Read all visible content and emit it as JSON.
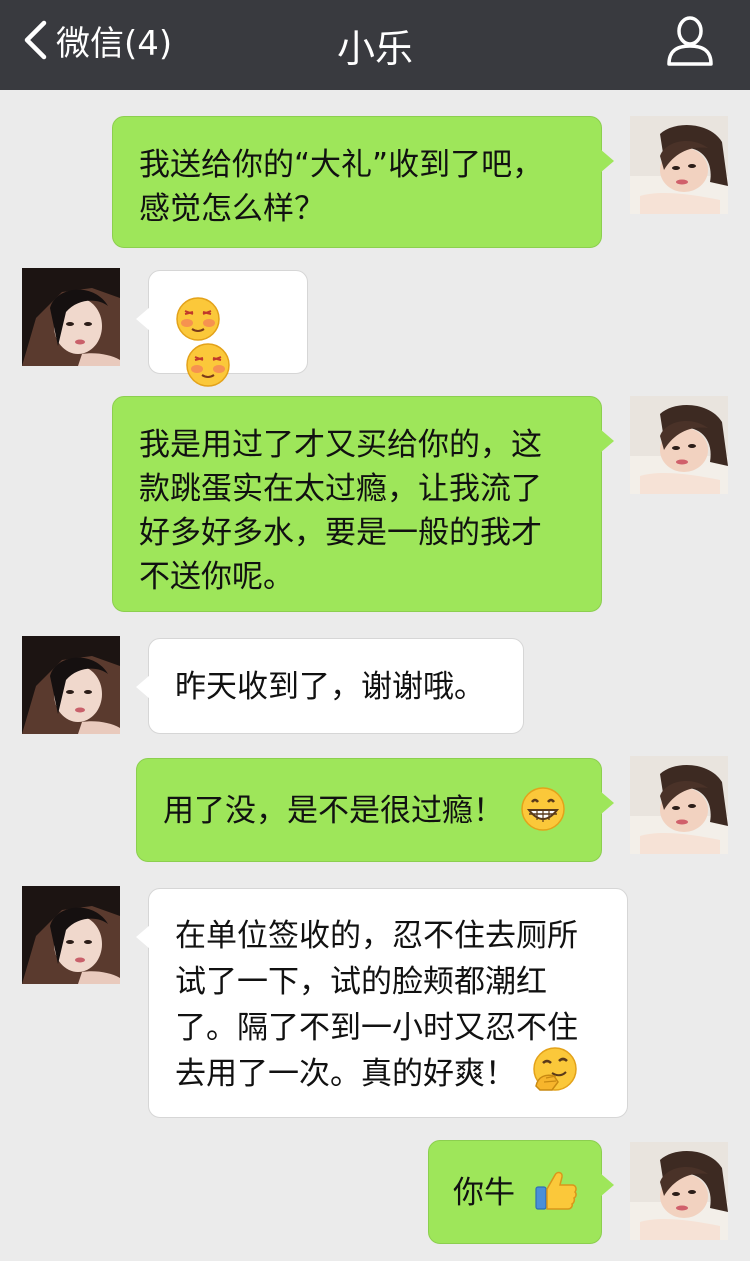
{
  "header": {
    "back_label": "微信(4)",
    "title": "小乐",
    "profile_icon": "person-icon"
  },
  "messages": [
    {
      "sender": "me",
      "lines": [
        "我送给你的“大礼”收到了吧，",
        "感觉怎么样？"
      ]
    },
    {
      "sender": "other",
      "emoji": [
        "blushing-face-icon",
        "blushing-face-icon"
      ]
    },
    {
      "sender": "me",
      "lines": [
        "我是用过了才又买给你的，这",
        "款跳蛋实在太过瘾，让我流了",
        "好多好多水，要是一般的我才",
        "不送你呢。"
      ]
    },
    {
      "sender": "other",
      "lines": [
        "昨天收到了，谢谢哦。"
      ]
    },
    {
      "sender": "me",
      "lines": [
        "用了没，是不是很过瘾！"
      ],
      "emoji_after": "grin-face-icon"
    },
    {
      "sender": "other",
      "lines": [
        "在单位签收的，忍不住去厕所",
        "试了一下，试的脸颊都潮红",
        "了。隔了不到一小时又忍不住",
        "去用了一次。真的好爽！"
      ],
      "emoji_after": "giggle-face-icon"
    },
    {
      "sender": "me",
      "lines": [
        "你牛"
      ],
      "emoji_after": "thumbs-up-icon"
    }
  ],
  "colors": {
    "header_bg": "#393a3f",
    "chat_bg": "#ebebeb",
    "my_bubble": "#9ee65a",
    "other_bubble": "#ffffff"
  }
}
